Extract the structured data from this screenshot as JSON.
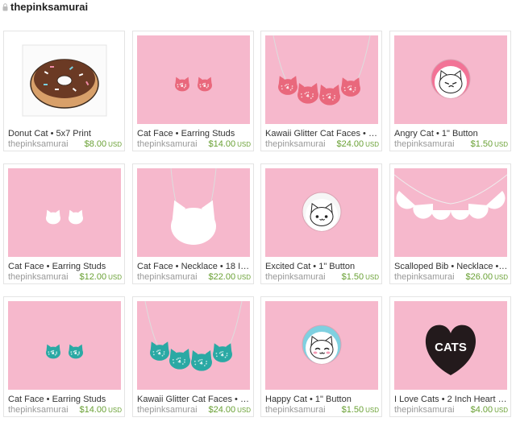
{
  "header": {
    "shop_name": "thepinksamurai"
  },
  "listings": [
    {
      "title": "Donut Cat • 5x7 Print",
      "shop": "thepinksamurai",
      "price": "$8.00",
      "currency": "USD",
      "image": "donut-cat-print"
    },
    {
      "title": "Cat Face • Earring Studs",
      "shop": "thepinksamurai",
      "price": "$14.00",
      "currency": "USD",
      "image": "pink-glitter-cat-studs"
    },
    {
      "title": "Kawaii Glitter Cat Faces • Ne...",
      "shop": "thepinksamurai",
      "price": "$24.00",
      "currency": "USD",
      "image": "pink-glitter-cat-necklace"
    },
    {
      "title": "Angry Cat • 1\" Button",
      "shop": "thepinksamurai",
      "price": "$1.50",
      "currency": "USD",
      "image": "angry-cat-button"
    },
    {
      "title": "Cat Face • Earring Studs",
      "shop": "thepinksamurai",
      "price": "$12.00",
      "currency": "USD",
      "image": "white-cat-studs"
    },
    {
      "title": "Cat Face • Necklace • 18 Inc...",
      "shop": "thepinksamurai",
      "price": "$22.00",
      "currency": "USD",
      "image": "white-cat-necklace"
    },
    {
      "title": "Excited Cat • 1\" Button",
      "shop": "thepinksamurai",
      "price": "$1.50",
      "currency": "USD",
      "image": "excited-cat-button"
    },
    {
      "title": "Scalloped Bib • Necklace • 18...",
      "shop": "thepinksamurai",
      "price": "$26.00",
      "currency": "USD",
      "image": "scalloped-bib-necklace"
    },
    {
      "title": "Cat Face • Earring Studs",
      "shop": "thepinksamurai",
      "price": "$14.00",
      "currency": "USD",
      "image": "teal-glitter-cat-studs"
    },
    {
      "title": "Kawaii Glitter Cat Faces • Ne...",
      "shop": "thepinksamurai",
      "price": "$24.00",
      "currency": "USD",
      "image": "teal-glitter-cat-necklace"
    },
    {
      "title": "Happy Cat • 1\" Button",
      "shop": "thepinksamurai",
      "price": "$1.50",
      "currency": "USD",
      "image": "happy-cat-button"
    },
    {
      "title": "I Love Cats • 2 Inch Heart Sh...",
      "shop": "thepinksamurai",
      "price": "$4.00",
      "currency": "USD",
      "image": "i-love-cats-heart",
      "heart_text": "CATS"
    }
  ],
  "colors": {
    "background_pink": "#f6b8cc",
    "price_green": "#6aa135",
    "glitter_pink": "#e9687c",
    "glitter_teal": "#2aa9a4"
  }
}
